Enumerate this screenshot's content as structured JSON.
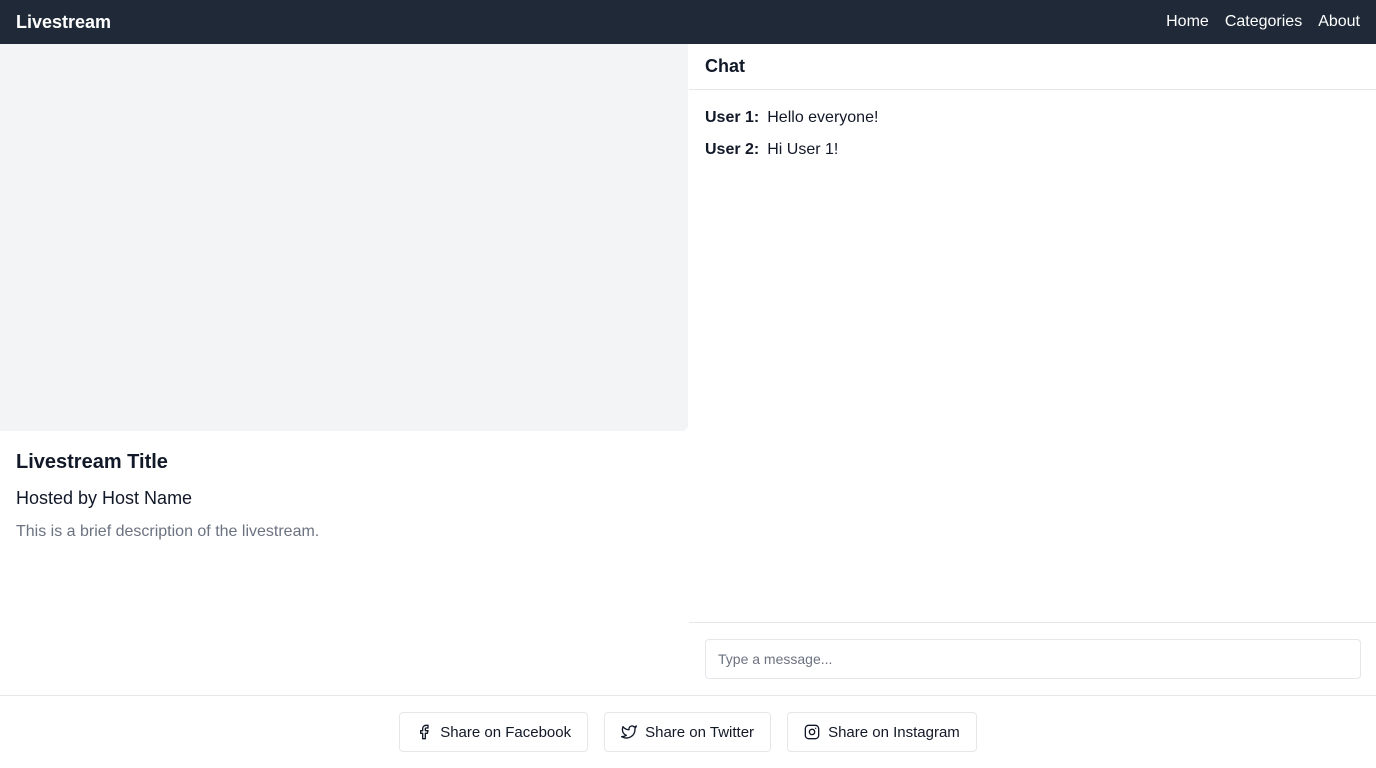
{
  "navbar": {
    "brand": "Livestream",
    "links": [
      {
        "label": "Home"
      },
      {
        "label": "Categories"
      },
      {
        "label": "About"
      }
    ]
  },
  "stream": {
    "title": "Livestream Title",
    "host": "Hosted by Host Name",
    "description": "This is a brief description of the livestream."
  },
  "chat": {
    "header": "Chat",
    "messages": [
      {
        "user": "User 1:",
        "text": "Hello everyone!"
      },
      {
        "user": "User 2:",
        "text": "Hi User 1!"
      }
    ],
    "input_placeholder": "Type a message..."
  },
  "share": {
    "buttons": [
      {
        "label": "Share on Facebook",
        "icon": "facebook-icon"
      },
      {
        "label": "Share on Twitter",
        "icon": "twitter-icon"
      },
      {
        "label": "Share on Instagram",
        "icon": "instagram-icon"
      }
    ]
  },
  "colors": {
    "navbar_bg": "#1f2937",
    "video_placeholder": "#f3f4f6",
    "muted_text": "#6b7280",
    "border": "#e5e7eb"
  }
}
